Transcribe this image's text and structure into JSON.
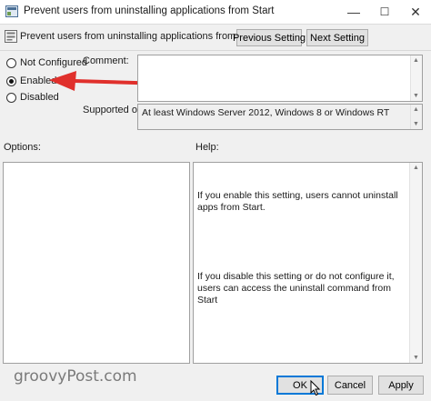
{
  "window": {
    "title": "Prevent users from uninstalling applications from Start",
    "minimize_glyph": "—",
    "maximize_glyph": "☐",
    "close_glyph": "✕"
  },
  "header": {
    "policy_name": "Prevent users from uninstalling applications from Start",
    "previous_label": "Previous Setting",
    "next_label": "Next Setting"
  },
  "state": {
    "options": [
      {
        "label": "Not Configured",
        "checked": false
      },
      {
        "label": "Enabled",
        "checked": true
      },
      {
        "label": "Disabled",
        "checked": false
      }
    ]
  },
  "comment": {
    "label": "Comment:",
    "value": ""
  },
  "supported": {
    "label": "Supported on:",
    "value": "At least Windows Server 2012, Windows 8 or Windows RT"
  },
  "sections": {
    "options_label": "Options:",
    "help_label": "Help:"
  },
  "help": {
    "paragraph1": "If you enable this setting, users cannot uninstall apps from Start.",
    "paragraph2": "If you disable this setting or do not configure it, users can access the uninstall command from Start"
  },
  "footer": {
    "ok_label": "OK",
    "cancel_label": "Cancel",
    "apply_label": "Apply"
  },
  "watermark": "groovyPost.com",
  "colors": {
    "arrow": "#e0302c",
    "focus": "#0078d7"
  }
}
